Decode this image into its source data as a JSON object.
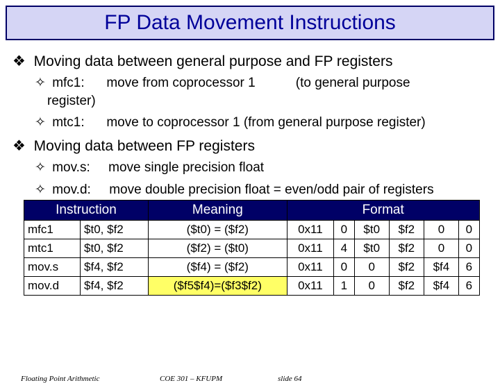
{
  "title": "FP Data Movement Instructions",
  "section1": "Moving data between general purpose and FP registers",
  "item1_name": "mfc1:",
  "item1_desc": "move from coprocessor 1",
  "item1_note": "(to general purpose",
  "item1_tail": "register)",
  "item2_name": "mtc1:",
  "item2_desc": "move to coprocessor 1   (from general purpose register)",
  "section2": "Moving data between FP registers",
  "item3_name": "mov.s:",
  "item3_desc": "move single precision float",
  "item4_name": "mov.d:",
  "item4_desc": "move double precision float = even/odd pair of registers",
  "th_instr": "Instruction",
  "th_meaning": "Meaning",
  "th_format": "Format",
  "rows": [
    {
      "a": "mfc1",
      "b": "$t0, $f2",
      "c": "($t0) = ($f2)",
      "d": "0x11",
      "e": "0",
      "f": "$t0",
      "g": "$f2",
      "h": "0",
      "i": "0"
    },
    {
      "a": "mtc1",
      "b": "$t0, $f2",
      "c": "($f2) = ($t0)",
      "d": "0x11",
      "e": "4",
      "f": "$t0",
      "g": "$f2",
      "h": "0",
      "i": "0"
    },
    {
      "a": "mov.s",
      "b": "$f4, $f2",
      "c": "($f4) = ($f2)",
      "d": "0x11",
      "e": "0",
      "f": "0",
      "g": "$f2",
      "h": "$f4",
      "i": "6"
    },
    {
      "a": "mov.d",
      "b": "$f4, $f2",
      "c": "($f5$f4)=($f3$f2)",
      "d": "0x11",
      "e": "1",
      "f": "0",
      "g": "$f2",
      "h": "$f4",
      "i": "6"
    }
  ],
  "footer_left": "Floating Point Arithmetic",
  "footer_mid": "COE 301 – KFUPM",
  "footer_right": "slide 64"
}
